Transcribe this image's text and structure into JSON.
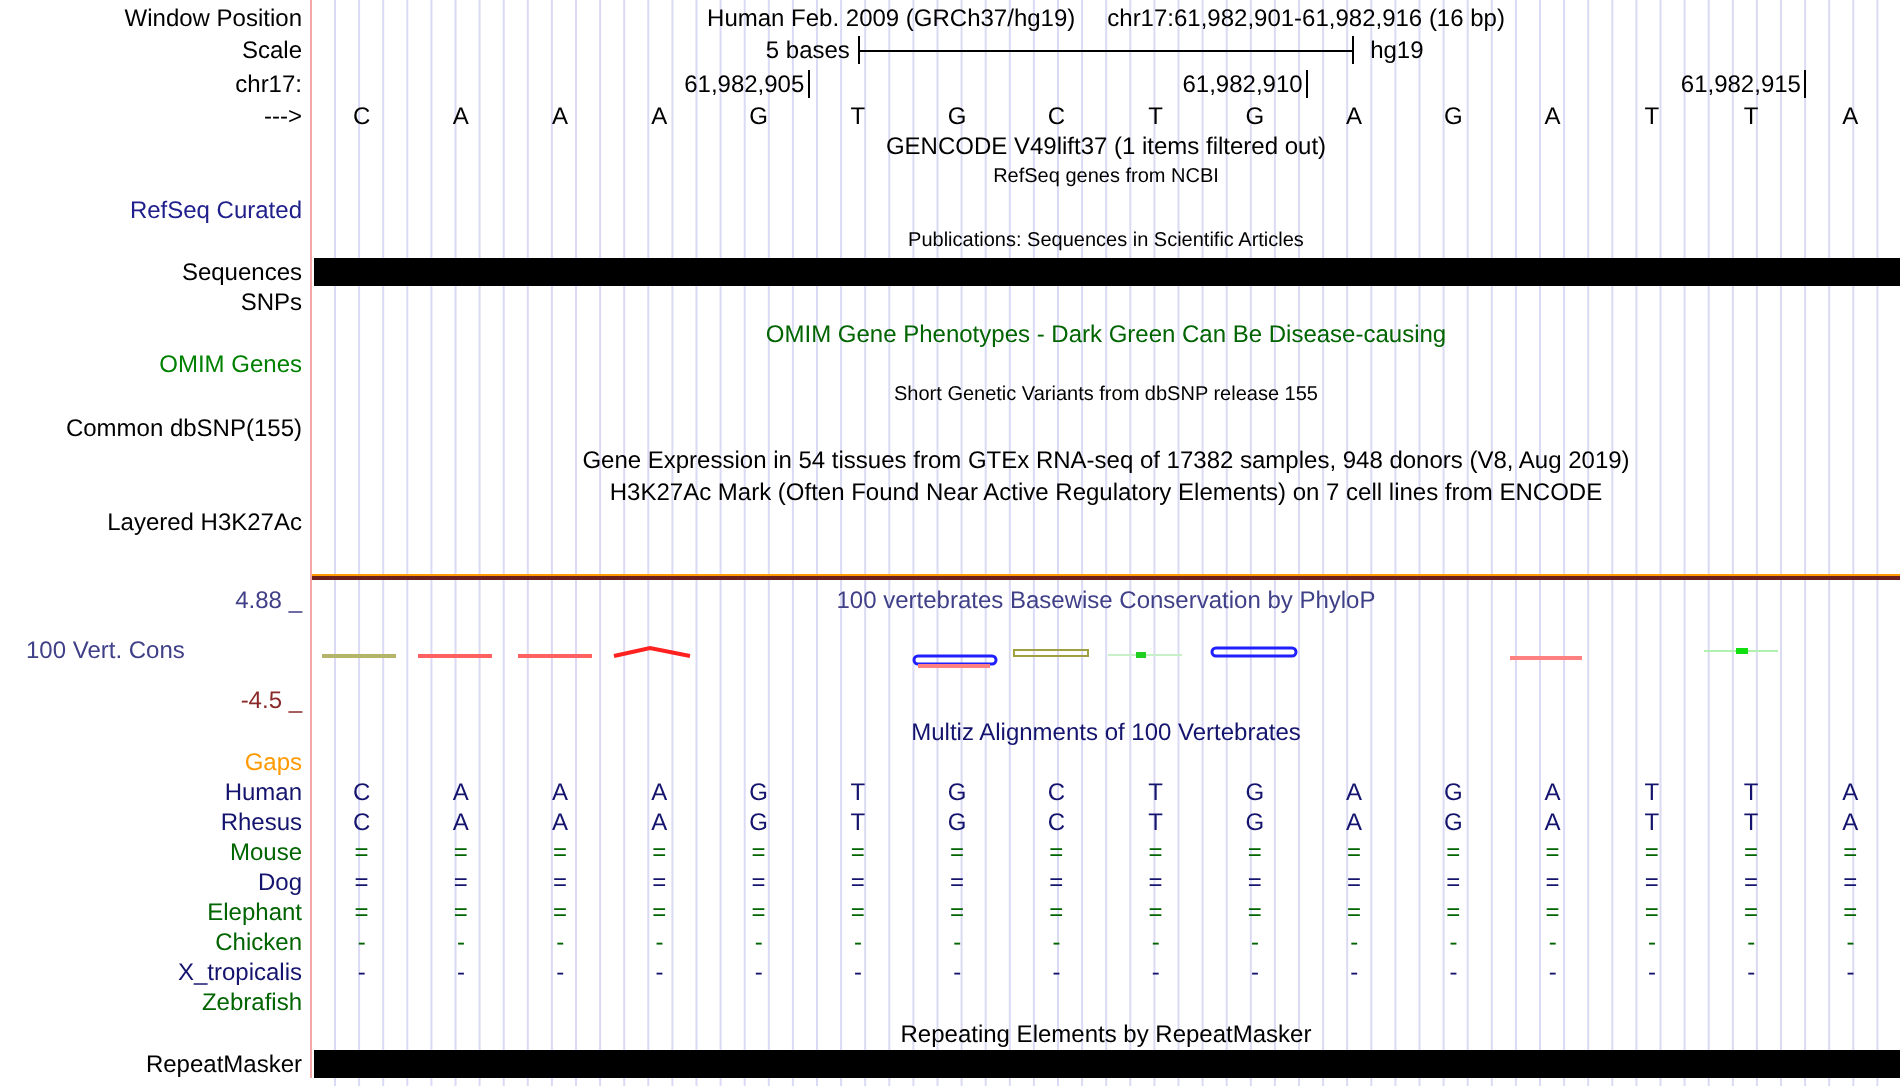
{
  "rows": [
    {
      "kind": "position",
      "label": "Window Position",
      "assembly": "Human Feb. 2009 (GRCh37/hg19)",
      "range": "chr17:61,982,901-61,982,916 (16 bp)"
    },
    {
      "kind": "scale",
      "label": "Scale",
      "text": "5 bases",
      "assembly": "hg19"
    },
    {
      "kind": "coordinates",
      "label": "chr17:",
      "ticks": [
        "61,982,905",
        "61,982,910",
        "61,982,915"
      ]
    },
    {
      "kind": "sequence",
      "label": "--->",
      "bases": [
        "C",
        "A",
        "A",
        "A",
        "G",
        "T",
        "G",
        "C",
        "T",
        "G",
        "A",
        "G",
        "A",
        "T",
        "T",
        "A"
      ]
    },
    {
      "kind": "title",
      "text": "GENCODE V49lift37 (1 items filtered out)",
      "color": "#000000"
    },
    {
      "kind": "caption",
      "text": "RefSeq genes from NCBI"
    },
    {
      "kind": "label",
      "label": "RefSeq Curated",
      "color": "#20208c"
    },
    {
      "kind": "caption",
      "text": "Publications: Sequences in Scientific Articles"
    },
    {
      "kind": "bar",
      "label": "Sequences"
    },
    {
      "kind": "label",
      "label": "SNPs",
      "color": "#000000"
    },
    {
      "kind": "title",
      "text": "OMIM Gene Phenotypes - Dark Green Can Be Disease-causing",
      "color": "#006400"
    },
    {
      "kind": "label",
      "label": "OMIM Genes",
      "color": "#008000"
    },
    {
      "kind": "caption",
      "text": "Short Genetic Variants from dbSNP release 155"
    },
    {
      "kind": "label",
      "label": "Common dbSNP(155)",
      "color": "#000000"
    },
    {
      "kind": "title",
      "text": "Gene Expression in 54 tissues from GTEx RNA-seq of 17382 samples, 948 donors (V8, Aug 2019)",
      "color": "#000000"
    },
    {
      "kind": "title",
      "text": "H3K27Ac Mark (Often Found Near Active Regulatory Elements) on 7 cell lines from ENCODE",
      "color": "#000000"
    },
    {
      "kind": "label",
      "label": "Layered H3K27Ac",
      "color": "#000000"
    },
    {
      "kind": "divider"
    },
    {
      "kind": "wiggle",
      "label": "100 Vert. Cons",
      "color": "#404088",
      "title": "100 vertebrates Basewise Conservation by PhyloP",
      "max": "4.88 _",
      "min": "-4.5 _"
    },
    {
      "kind": "title",
      "text": "Multiz Alignments of 100 Vertebrates",
      "color": "#14146e"
    },
    {
      "kind": "alignment",
      "label": "Gaps",
      "color": "#ff9900"
    },
    {
      "kind": "alignment",
      "label": "Human",
      "color": "#14146e",
      "bases": [
        "C",
        "A",
        "A",
        "A",
        "G",
        "T",
        "G",
        "C",
        "T",
        "G",
        "A",
        "G",
        "A",
        "T",
        "T",
        "A"
      ]
    },
    {
      "kind": "alignment",
      "label": "Rhesus",
      "color": "#14146e",
      "bases": [
        "C",
        "A",
        "A",
        "A",
        "G",
        "T",
        "G",
        "C",
        "T",
        "G",
        "A",
        "G",
        "A",
        "T",
        "T",
        "A"
      ]
    },
    {
      "kind": "alignment",
      "label": "Mouse",
      "color": "#006400",
      "bases": [
        "=",
        "=",
        "=",
        "=",
        "=",
        "=",
        "=",
        "=",
        "=",
        "=",
        "=",
        "=",
        "=",
        "=",
        "=",
        "="
      ]
    },
    {
      "kind": "alignment",
      "label": "Dog",
      "color": "#14146e",
      "bases": [
        "=",
        "=",
        "=",
        "=",
        "=",
        "=",
        "=",
        "=",
        "=",
        "=",
        "=",
        "=",
        "=",
        "=",
        "=",
        "="
      ]
    },
    {
      "kind": "alignment",
      "label": "Elephant",
      "color": "#006400",
      "bases": [
        "=",
        "=",
        "=",
        "=",
        "=",
        "=",
        "=",
        "=",
        "=",
        "=",
        "=",
        "=",
        "=",
        "=",
        "=",
        "="
      ]
    },
    {
      "kind": "alignment",
      "label": "Chicken",
      "color": "#006400",
      "bases": [
        "-",
        "-",
        "-",
        "-",
        "-",
        "-",
        "-",
        "-",
        "-",
        "-",
        "-",
        "-",
        "-",
        "-",
        "-",
        "-"
      ]
    },
    {
      "kind": "alignment",
      "label": "X_tropicalis",
      "color": "#14146e",
      "bases": [
        "-",
        "-",
        "-",
        "-",
        "-",
        "-",
        "-",
        "-",
        "-",
        "-",
        "-",
        "-",
        "-",
        "-",
        "-",
        "-"
      ]
    },
    {
      "kind": "alignment",
      "label": "Zebrafish",
      "color": "#006400"
    },
    {
      "kind": "title",
      "text": "Repeating Elements by RepeatMasker",
      "color": "#000000"
    },
    {
      "kind": "bar",
      "label": "RepeatMasker"
    }
  ]
}
